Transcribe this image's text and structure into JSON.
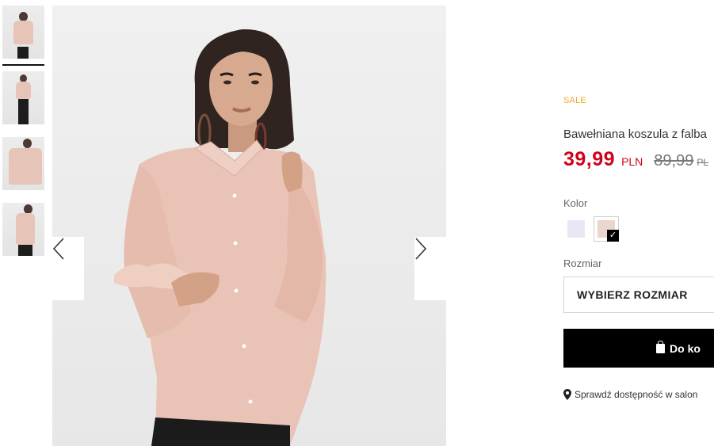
{
  "gallery": {
    "thumbnails": [
      {
        "view": "front-closeup",
        "active": true
      },
      {
        "view": "full-length"
      },
      {
        "view": "ruffle-detail"
      },
      {
        "view": "side"
      }
    ],
    "prev_icon": "chevron-left-icon",
    "next_icon": "chevron-right-icon"
  },
  "product": {
    "badge": "SALE",
    "title": "Bawełniana koszula z falba",
    "price": {
      "current": "39,99",
      "current_currency": "PLN",
      "old": "89,99",
      "old_currency": "PL"
    },
    "color_label": "Kolor",
    "colors": [
      {
        "hex": "#e9e7f6",
        "selected": false
      },
      {
        "hex": "#ead5cf",
        "selected": true
      }
    ],
    "selected_mark": "✓",
    "size_label": "Rozmiar",
    "size_placeholder": "WYBIERZ ROZMIAR",
    "add_to_cart": "Do ko",
    "store_check": "Sprawdź dostępność w salon"
  },
  "colors": {
    "sale": "#f5a623",
    "price": "#d0021b",
    "button": "#000000"
  }
}
